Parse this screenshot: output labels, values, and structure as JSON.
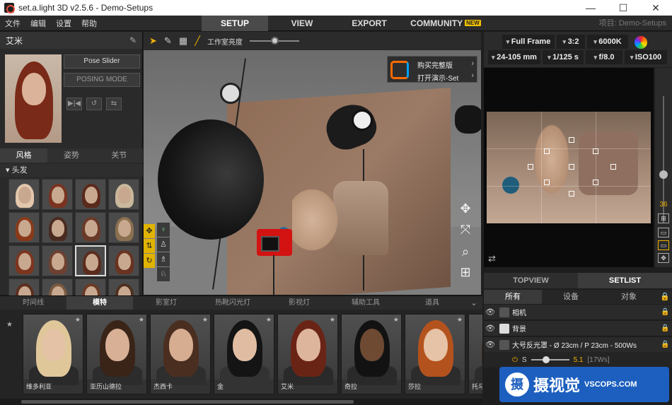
{
  "window": {
    "title": "set.a.light 3D v2.5.6 - Demo-Setups",
    "controls": [
      "—",
      "☐",
      "✕"
    ]
  },
  "menu": {
    "items": [
      "文件",
      "编辑",
      "设置",
      "帮助"
    ]
  },
  "main_tabs": [
    {
      "label": "SETUP",
      "active": true
    },
    {
      "label": "VIEW",
      "active": false
    },
    {
      "label": "EXPORT",
      "active": false
    },
    {
      "label": "COMMUNITY",
      "active": false,
      "badge": "NEW"
    }
  ],
  "project_label": "项目: Demo-Setups",
  "left_panel": {
    "title": "艾米",
    "pose_slider": "Pose Slider",
    "posing_mode": "POSING MODE",
    "subtabs": [
      {
        "label": "风格",
        "active": true
      },
      {
        "label": "姿势",
        "active": false
      },
      {
        "label": "关节",
        "active": false
      }
    ],
    "section": "头发",
    "hair_colors": [
      "#e3c7ad",
      "#7a3320",
      "#5a2a1c",
      "#c9b89c",
      "#8a3a1a",
      "#4a2a20",
      "#6a3a28",
      "#8a7050",
      "#7d3520",
      "#6e4030",
      "#5b2c1e",
      "#6a3220",
      "#5c2e1e",
      "#7a5a40",
      "#6b3a24",
      "#4e3020"
    ],
    "selected_hair_index": 10
  },
  "toolbar": {
    "brightness_label": "工作室亮度"
  },
  "viewport": {
    "buy_full": "购买完整版",
    "open_demo": "打开演示-Set"
  },
  "camera": {
    "sensor": "Full Frame",
    "ratio": "3:2",
    "wb": "6000K",
    "lens": "24-105 mm",
    "shutter": "1/125 s",
    "aperture": "f/8.0",
    "iso": "ISO100",
    "zoom_value": "36"
  },
  "setlist": {
    "tabs": [
      {
        "label": "TOPVIEW",
        "active": false
      },
      {
        "label": "SETLIST",
        "active": true
      }
    ],
    "filters": [
      {
        "label": "所有",
        "active": true
      },
      {
        "label": "设备",
        "active": false
      },
      {
        "label": "对象",
        "active": false
      }
    ],
    "rows": [
      {
        "label": "相机"
      },
      {
        "label": "背景"
      },
      {
        "label": "大号反光罩 - Ø 23cm / P 23cm - 500Ws"
      }
    ],
    "sub": {
      "label": "S",
      "value": "5.1",
      "unit": "[17Ws]"
    }
  },
  "bottom_tabs": [
    {
      "label": "时间线",
      "active": false
    },
    {
      "label": "模特",
      "active": true
    },
    {
      "label": "影室灯",
      "active": false
    },
    {
      "label": "热靴闪光灯",
      "active": false
    },
    {
      "label": "影视灯",
      "active": false
    },
    {
      "label": "辅助工具",
      "active": false
    },
    {
      "label": "道具",
      "active": false
    }
  ],
  "models": [
    {
      "name": "维多利亚",
      "hair": "#e0c79a",
      "skin": "#e3c2a6",
      "top": "#2a2a2a"
    },
    {
      "name": "亚历山德拉",
      "hair": "#3a2418",
      "skin": "#d8b096",
      "top": "#2c2c2c"
    },
    {
      "name": "杰西卡",
      "hair": "#4a2e20",
      "skin": "#d6ad90",
      "top": "#2e2e2e"
    },
    {
      "name": "金",
      "hair": "#141414",
      "skin": "#e0bda2",
      "top": "#333333"
    },
    {
      "name": "艾米",
      "hair": "#6a2416",
      "skin": "#ddb59c",
      "top": "#2a2a2a"
    },
    {
      "name": "奇拉",
      "hair": "#121212",
      "skin": "#6e4a33",
      "top": "#2a2a2a"
    },
    {
      "name": "莎拉",
      "hair": "#b4521e",
      "skin": "#e6c2a6",
      "top": "#2c2c2c"
    },
    {
      "name": "托马",
      "hair": "#3a2a20",
      "skin": "#d8b096",
      "top": "#2c2c2c"
    }
  ],
  "watermark": {
    "glyph": "摄",
    "text": "摄视觉",
    "url": "VSCOPS.COM"
  },
  "colors": {
    "accent": "#f0b000",
    "brand_red": "#d31212"
  }
}
